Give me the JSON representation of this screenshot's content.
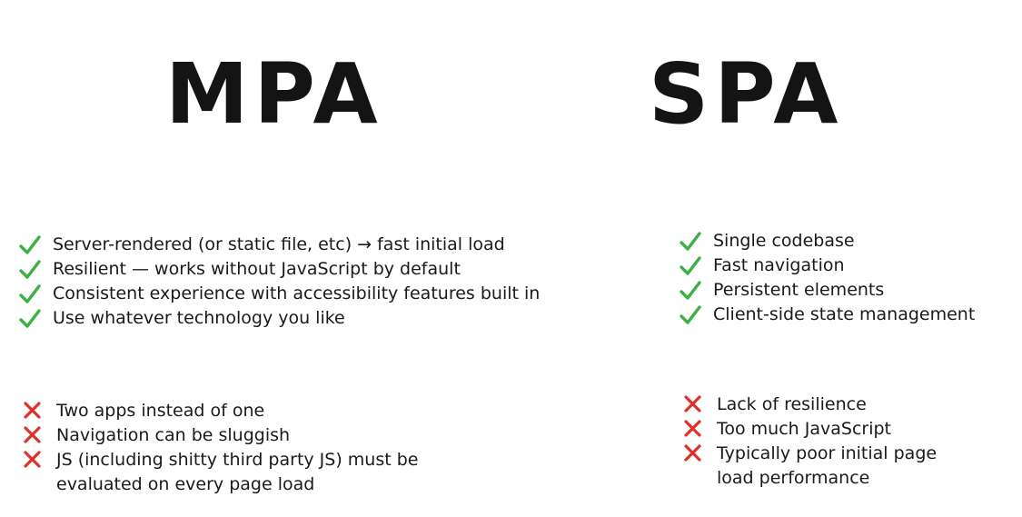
{
  "mpa": {
    "title": "MPA",
    "pros": [
      "Server-rendered (or static file, etc) → fast initial load",
      "Resilient — works without JavaScript by default",
      "Consistent experience with accessibility features built in",
      "Use whatever technology you like"
    ],
    "cons": [
      "Two apps instead of one",
      "Navigation can be sluggish",
      "JS (including shitty third party JS) must be evaluated on every page load"
    ]
  },
  "spa": {
    "title": "SPA",
    "pros": [
      "Single codebase",
      "Fast navigation",
      "Persistent elements",
      "Client-side state management"
    ],
    "cons": [
      "Lack of resilience",
      "Too much JavaScript",
      "Typically poor initial page load performance"
    ]
  },
  "icons": {
    "pro": "check-icon",
    "con": "cross-icon"
  },
  "colors": {
    "check": "#3cb043",
    "cross": "#e0302a",
    "text": "#1a1a1a",
    "background": "#ffffff"
  }
}
